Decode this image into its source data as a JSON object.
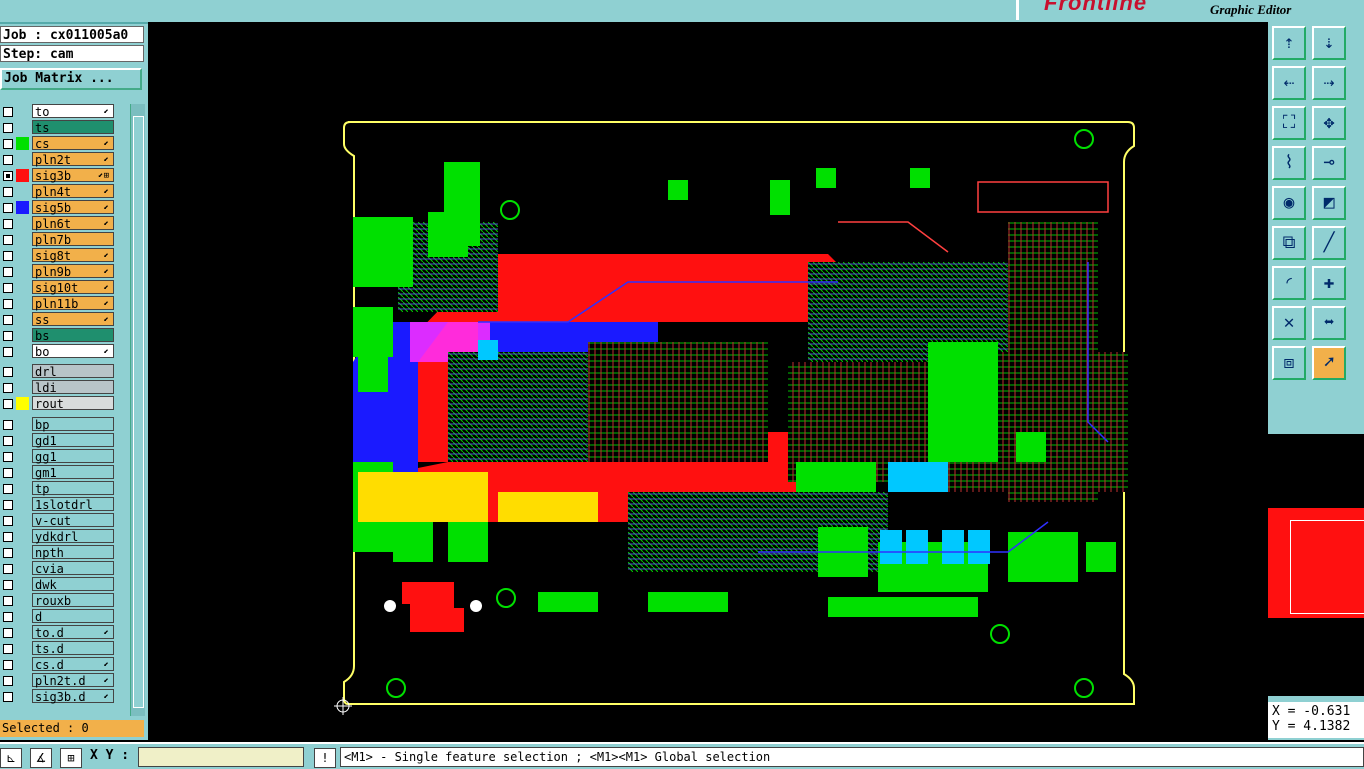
{
  "header": {
    "brand": "Frontline",
    "subtitle": "Graphic Editor"
  },
  "job": {
    "job_label": "Job : cx011005a0",
    "step_label": "Step: cam",
    "matrix_button": "Job Matrix ..."
  },
  "layers": [
    {
      "name": "to",
      "bg": "#ffffff",
      "color": "",
      "checked": false,
      "mark": "⬋"
    },
    {
      "name": "ts",
      "bg": "#1f8f6e",
      "color": "",
      "checked": false,
      "mark": ""
    },
    {
      "name": "cs",
      "bg": "#f2b04a",
      "color": "#00e000",
      "checked": false,
      "mark": "⬋"
    },
    {
      "name": "pln2t",
      "bg": "#f2b04a",
      "color": "",
      "checked": false,
      "mark": "⬋"
    },
    {
      "name": "sig3b",
      "bg": "#f2b04a",
      "color": "#ff1010",
      "checked": true,
      "mark": "⬋⊞"
    },
    {
      "name": "pln4t",
      "bg": "#f2b04a",
      "color": "",
      "checked": false,
      "mark": "⬋"
    },
    {
      "name": "sig5b",
      "bg": "#f2b04a",
      "color": "#1a1aff",
      "checked": false,
      "mark": "⬋"
    },
    {
      "name": "pln6t",
      "bg": "#f2b04a",
      "color": "",
      "checked": false,
      "mark": "⬋"
    },
    {
      "name": "pln7b",
      "bg": "#f2b04a",
      "color": "",
      "checked": false,
      "mark": ""
    },
    {
      "name": "sig8t",
      "bg": "#f2b04a",
      "color": "",
      "checked": false,
      "mark": "⬋"
    },
    {
      "name": "pln9b",
      "bg": "#f2b04a",
      "color": "",
      "checked": false,
      "mark": "⬋"
    },
    {
      "name": "sig10t",
      "bg": "#f2b04a",
      "color": "",
      "checked": false,
      "mark": "⬋"
    },
    {
      "name": "pln11b",
      "bg": "#f2b04a",
      "color": "",
      "checked": false,
      "mark": "⬋"
    },
    {
      "name": "ss",
      "bg": "#f2b04a",
      "color": "",
      "checked": false,
      "mark": "⬋"
    },
    {
      "name": "bs",
      "bg": "#1f8f6e",
      "color": "",
      "checked": false,
      "mark": ""
    },
    {
      "name": "bo",
      "bg": "#ffffff",
      "color": "",
      "checked": false,
      "mark": "⬋"
    },
    {
      "name": "drl",
      "bg": "#b8c4c8",
      "color": "",
      "checked": false,
      "mark": ""
    },
    {
      "name": "ldi",
      "bg": "#b8c4c8",
      "color": "",
      "checked": false,
      "mark": ""
    },
    {
      "name": "rout",
      "bg": "#d8dcdc",
      "color": "#ffff00",
      "checked": false,
      "mark": ""
    },
    {
      "name": "bp",
      "bg": "#8fd0d2",
      "color": "",
      "checked": false,
      "mark": ""
    },
    {
      "name": "gd1",
      "bg": "#8fd0d2",
      "color": "",
      "checked": false,
      "mark": ""
    },
    {
      "name": "gg1",
      "bg": "#8fd0d2",
      "color": "",
      "checked": false,
      "mark": ""
    },
    {
      "name": "gm1",
      "bg": "#8fd0d2",
      "color": "",
      "checked": false,
      "mark": ""
    },
    {
      "name": "tp",
      "bg": "#8fd0d2",
      "color": "",
      "checked": false,
      "mark": ""
    },
    {
      "name": "1slotdrl",
      "bg": "#8fd0d2",
      "color": "",
      "checked": false,
      "mark": ""
    },
    {
      "name": "v-cut",
      "bg": "#8fd0d2",
      "color": "",
      "checked": false,
      "mark": ""
    },
    {
      "name": "ydkdrl",
      "bg": "#8fd0d2",
      "color": "",
      "checked": false,
      "mark": ""
    },
    {
      "name": "npth",
      "bg": "#8fd0d2",
      "color": "",
      "checked": false,
      "mark": ""
    },
    {
      "name": "cvia",
      "bg": "#8fd0d2",
      "color": "",
      "checked": false,
      "mark": ""
    },
    {
      "name": "dwk",
      "bg": "#8fd0d2",
      "color": "",
      "checked": false,
      "mark": ""
    },
    {
      "name": "rouxb",
      "bg": "#8fd0d2",
      "color": "",
      "checked": false,
      "mark": ""
    },
    {
      "name": "d",
      "bg": "#8fd0d2",
      "color": "",
      "checked": false,
      "mark": ""
    },
    {
      "name": "to.d",
      "bg": "#8fd0d2",
      "color": "",
      "checked": false,
      "mark": "⬋"
    },
    {
      "name": "ts.d",
      "bg": "#8fd0d2",
      "color": "",
      "checked": false,
      "mark": ""
    },
    {
      "name": "cs.d",
      "bg": "#8fd0d2",
      "color": "",
      "checked": false,
      "mark": "⬋"
    },
    {
      "name": "pln2t.d",
      "bg": "#8fd0d2",
      "color": "",
      "checked": false,
      "mark": "⬋"
    },
    {
      "name": "sig3b.d",
      "bg": "#8fd0d2",
      "color": "",
      "checked": false,
      "mark": "⬋"
    }
  ],
  "status": {
    "selected": "Selected : 0"
  },
  "coords": {
    "x": "X = -0.631",
    "y": "Y = 4.1382"
  },
  "bottom": {
    "xy_label": "X Y :",
    "xy_value": "",
    "message": "<M1> - Single feature selection ; <M1><M1> Global selection"
  },
  "toolbar": [
    "top-view-icon",
    "bottom-view-icon",
    "left-icon",
    "right-icon",
    "fit-icon",
    "center-icon",
    "measure-icon",
    "ruler-icon",
    "snap-icon",
    "select-icon",
    "pad-icon",
    "line-icon",
    "arc-icon",
    "add-icon",
    "delete-icon",
    "move-icon",
    "copy-icon",
    "cursor-icon"
  ],
  "colors": {
    "board_outline": "#ffff66",
    "copper": "#00e000",
    "inner": "#ff1010",
    "sig5": "#1a1aff"
  }
}
